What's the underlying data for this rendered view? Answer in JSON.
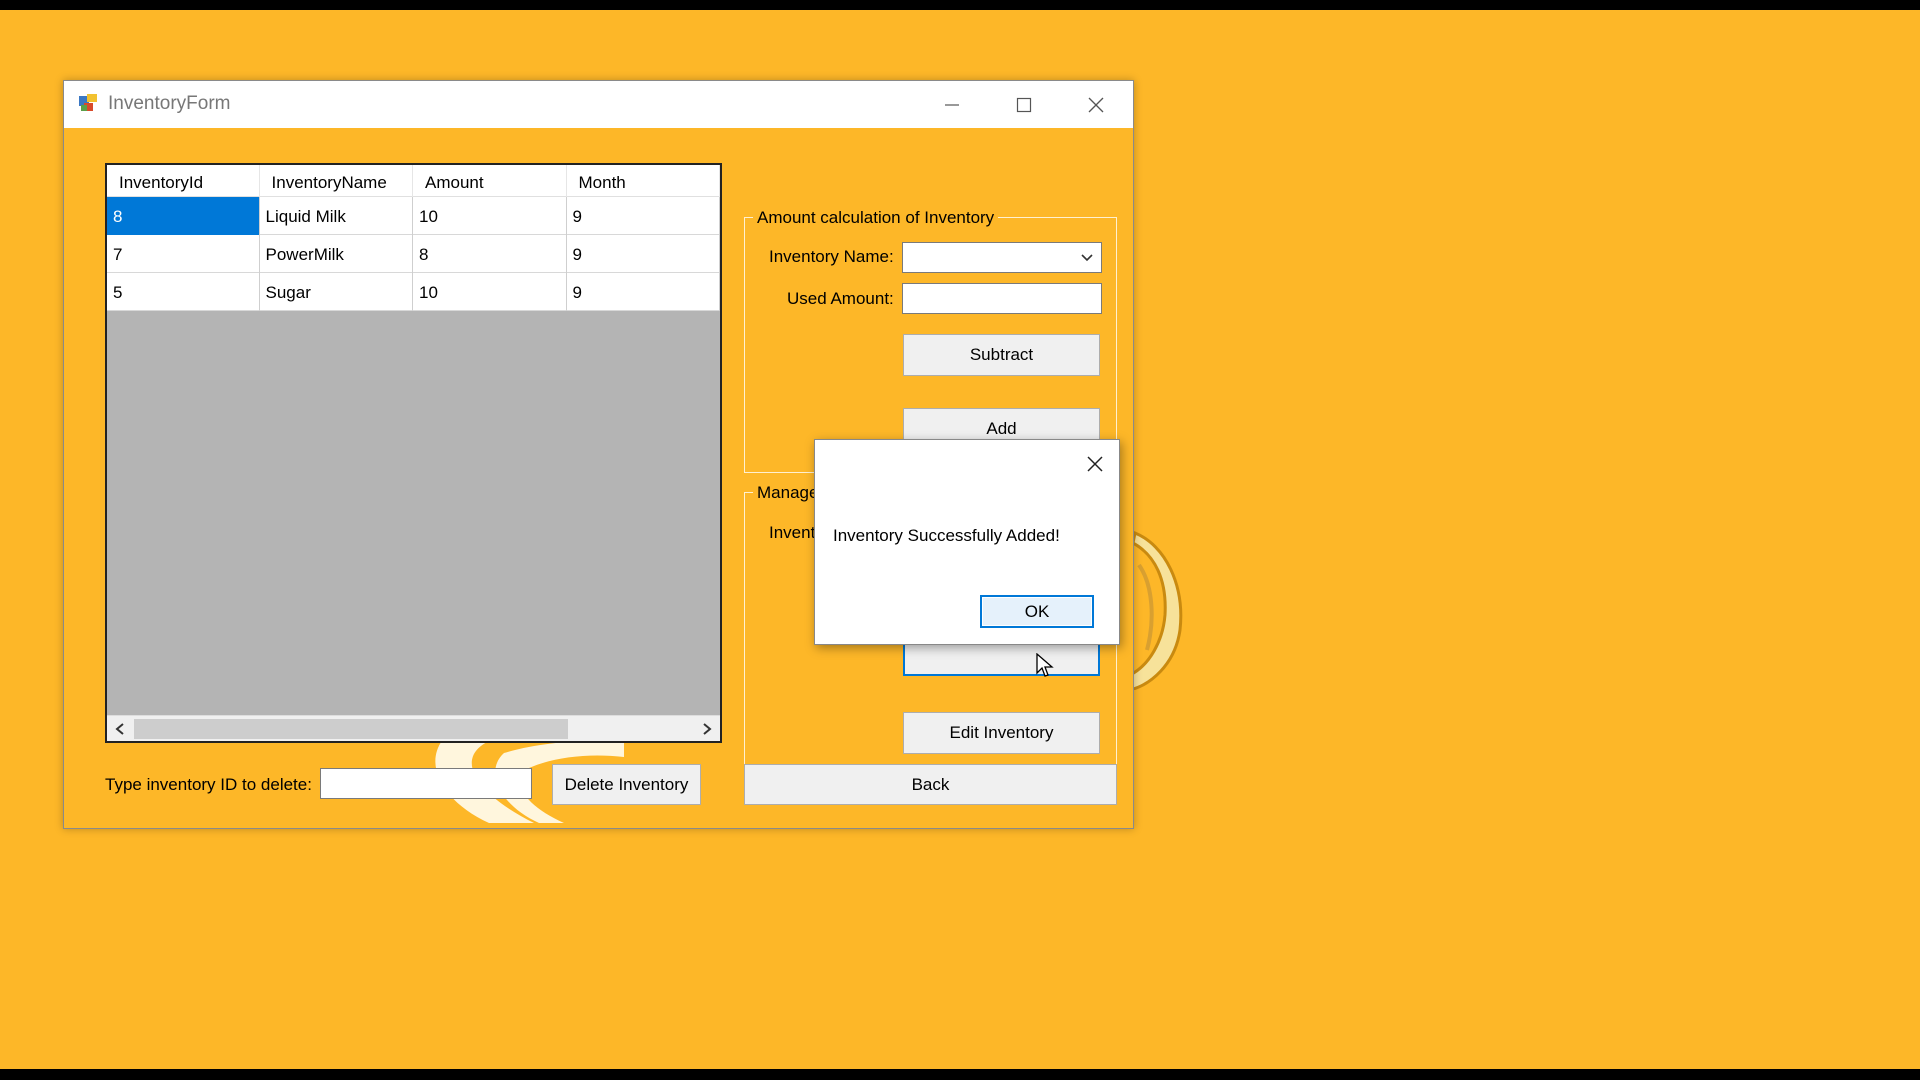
{
  "window": {
    "title": "InventoryForm",
    "icon": "app-form-icon",
    "controls": [
      "minimize-icon",
      "maximize-icon",
      "close-icon"
    ]
  },
  "grid": {
    "columns": [
      "InventoryId",
      "InventoryName",
      "Amount",
      "Month"
    ],
    "rows": [
      [
        "8",
        "Liquid Milk",
        "10",
        "9"
      ],
      [
        "7",
        "PowerMilk",
        "8",
        "9"
      ],
      [
        "5",
        "Sugar",
        "10",
        "9"
      ]
    ],
    "selected_cell": "8"
  },
  "delete_section": {
    "label": "Type inventory ID to delete:",
    "input_value": "",
    "button_label": "Delete Inventory"
  },
  "amount_group": {
    "title": "Amount calculation of Inventory",
    "inventory_name_label": "Inventory Name:",
    "inventory_name_value": "",
    "used_amount_label": "Used Amount:",
    "used_amount_value": "",
    "subtract_label": "Subtract",
    "add_label": "Add"
  },
  "manage_group": {
    "title_visible": "Manage",
    "field_label_visible": "Invent",
    "edit_label": "Edit Inventory"
  },
  "back_label": "Back",
  "dialog": {
    "message": "Inventory Successfully Added!",
    "ok_label": "OK"
  },
  "colors": {
    "desktop": "#FDB728",
    "selection": "#0078D7"
  }
}
